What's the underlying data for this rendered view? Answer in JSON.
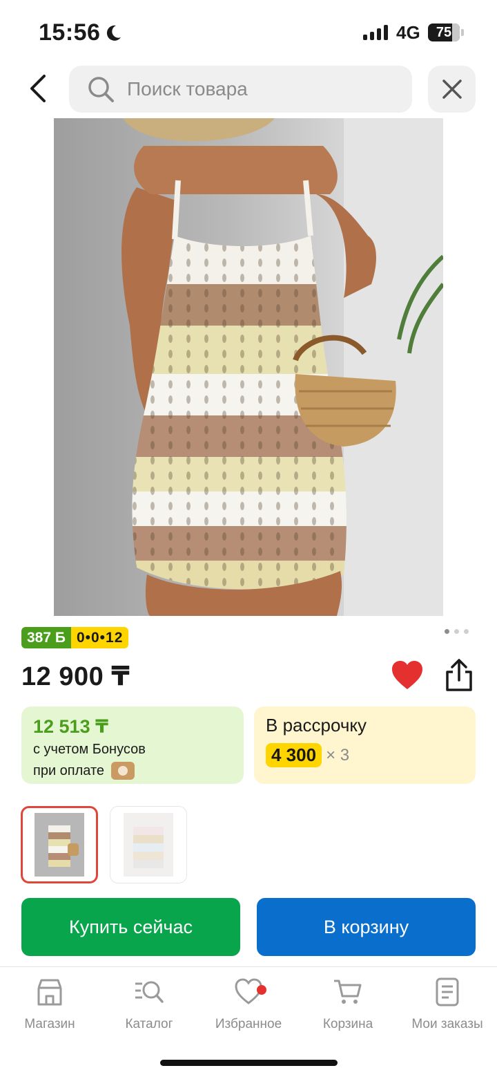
{
  "status_bar": {
    "time": "15:56",
    "network": "4G",
    "battery_level": "75",
    "battery_fraction": 0.75
  },
  "header": {
    "search_placeholder": "Поиск товара",
    "back_icon": "chevron-left-icon",
    "close_icon": "close-icon"
  },
  "product": {
    "badge_bonus": "387 Б",
    "badge_installment": "0•0•12",
    "price": "12 900 ₸",
    "favorited": true,
    "image_count": 3,
    "active_image": 1
  },
  "bonus_card": {
    "price": "12 513 ₸",
    "line1": "с учетом Бонусов",
    "line2": "при оплате"
  },
  "installment_card": {
    "title": "В рассрочку",
    "amount": "4 300",
    "times": "× 3"
  },
  "actions": {
    "buy_now": "Купить сейчас",
    "add_to_cart": "В корзину"
  },
  "tab_bar": {
    "items": [
      {
        "label": "Магазин",
        "icon": "shop-icon"
      },
      {
        "label": "Каталог",
        "icon": "catalog-search-icon"
      },
      {
        "label": "Избранное",
        "icon": "heart-icon"
      },
      {
        "label": "Корзина",
        "icon": "cart-icon"
      },
      {
        "label": "Мои заказы",
        "icon": "orders-icon"
      }
    ]
  },
  "colors": {
    "green_button": "#09a54c",
    "blue_button": "#0a6fcc",
    "favorite_red": "#e53030",
    "bonus_green": "#4a9e1c",
    "installment_yellow": "#ffd500"
  }
}
